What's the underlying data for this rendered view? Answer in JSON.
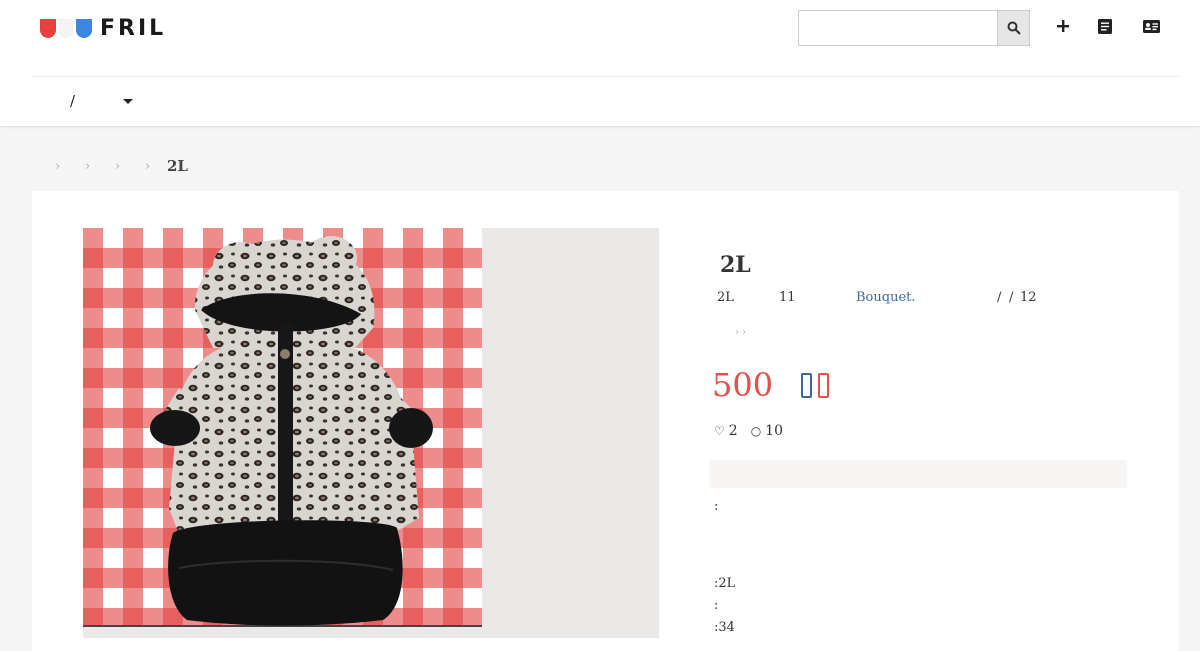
{
  "header": {
    "logo_text": "FRIL",
    "logo_colors": [
      "#e8403c",
      "#ffffff",
      "#3b86e0"
    ],
    "search": {
      "value": "",
      "placeholder": ""
    },
    "icons": [
      "search-icon",
      "plus-icon",
      "document-icon",
      "id-card-icon"
    ],
    "nav_separator": "/"
  },
  "breadcrumb": {
    "separators": [
      "›",
      "›",
      "›",
      "›"
    ],
    "current": "2L"
  },
  "product": {
    "title": "2L",
    "size": "2L",
    "condition": "11",
    "brand": "Bouquet.",
    "date_sep1": "/",
    "date_sep2": "/",
    "date_num": "12",
    "sub_arrows": "› ›",
    "price": "500",
    "likes": "2",
    "comments": "10",
    "accent_color": "#e2504c",
    "ship_colors": [
      "#3b6aa0",
      "#e2504c"
    ]
  },
  "description": {
    "line1": ":",
    "line2": ":2L",
    "line3": ":",
    "line4": ":34"
  }
}
